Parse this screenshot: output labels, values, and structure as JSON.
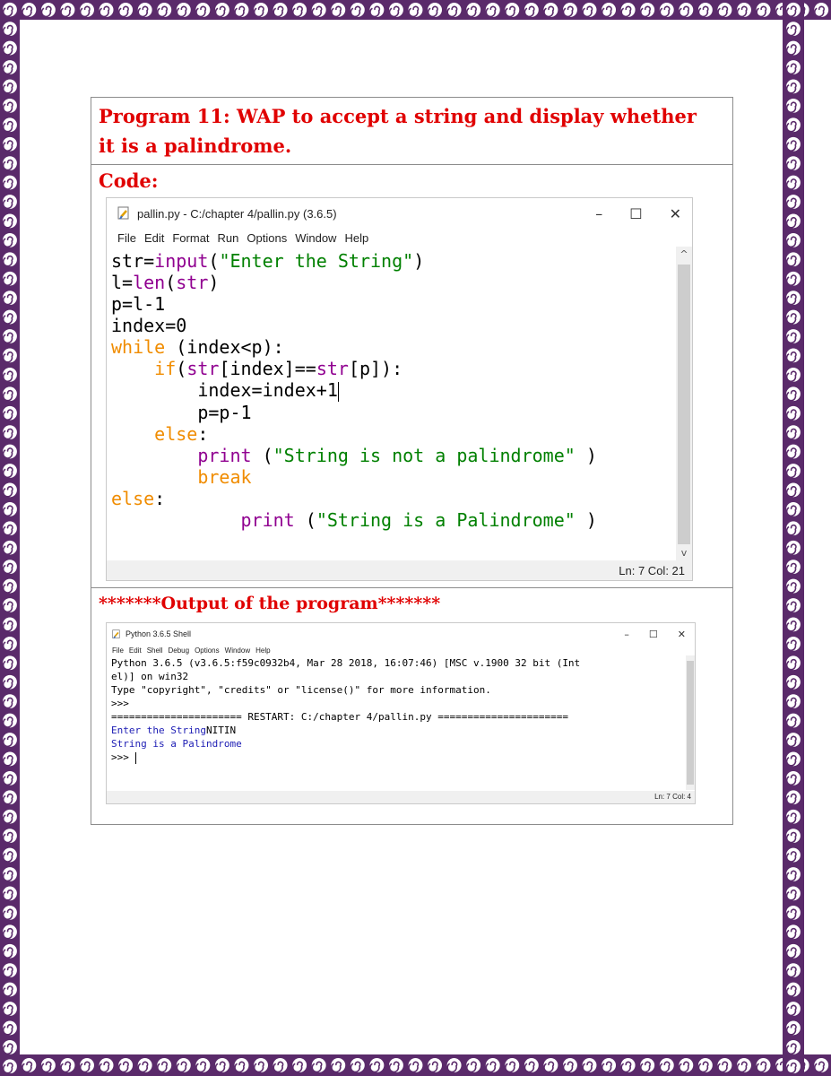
{
  "program_heading": "Program 11: WAP to accept a string and display whether it is a palindrome.",
  "code_label": "Code:",
  "editor": {
    "title": "pallin.py - C:/chapter 4/pallin.py (3.6.5)",
    "menu": [
      "File",
      "Edit",
      "Format",
      "Run",
      "Options",
      "Window",
      "Help"
    ],
    "window_buttons": {
      "minimize": "–",
      "maximize": "☐",
      "close": "✕"
    },
    "code_lines": [
      [
        {
          "t": "str=",
          "c": "plain"
        },
        {
          "t": "input",
          "c": "bi"
        },
        {
          "t": "(",
          "c": "plain"
        },
        {
          "t": "\"Enter the String\"",
          "c": "str"
        },
        {
          "t": ")",
          "c": "plain"
        }
      ],
      [
        {
          "t": "l=",
          "c": "plain"
        },
        {
          "t": "len",
          "c": "bi"
        },
        {
          "t": "(",
          "c": "plain"
        },
        {
          "t": "str",
          "c": "bi"
        },
        {
          "t": ")",
          "c": "plain"
        }
      ],
      [
        {
          "t": "p=l-1",
          "c": "plain"
        }
      ],
      [
        {
          "t": "index=0",
          "c": "plain"
        }
      ],
      [
        {
          "t": "while",
          "c": "kw"
        },
        {
          "t": " (index<p):",
          "c": "plain"
        }
      ],
      [
        {
          "t": "    ",
          "c": "plain"
        },
        {
          "t": "if",
          "c": "kw"
        },
        {
          "t": "(",
          "c": "plain"
        },
        {
          "t": "str",
          "c": "bi"
        },
        {
          "t": "[index]==",
          "c": "plain"
        },
        {
          "t": "str",
          "c": "bi"
        },
        {
          "t": "[p]):",
          "c": "plain"
        }
      ],
      [
        {
          "t": "        index=index+1",
          "c": "plain"
        },
        {
          "t": "",
          "c": "cursor"
        }
      ],
      [
        {
          "t": "        p=p-1",
          "c": "plain"
        }
      ],
      [
        {
          "t": "    ",
          "c": "plain"
        },
        {
          "t": "else",
          "c": "kw"
        },
        {
          "t": ":",
          "c": "plain"
        }
      ],
      [
        {
          "t": "        ",
          "c": "plain"
        },
        {
          "t": "print",
          "c": "bi"
        },
        {
          "t": " (",
          "c": "plain"
        },
        {
          "t": "\"String is not a palindrome\"",
          "c": "str"
        },
        {
          "t": " )",
          "c": "plain"
        }
      ],
      [
        {
          "t": "        ",
          "c": "plain"
        },
        {
          "t": "break",
          "c": "kw"
        }
      ],
      [
        {
          "t": "else",
          "c": "kw"
        },
        {
          "t": ":",
          "c": "plain"
        }
      ],
      [
        {
          "t": "            ",
          "c": "plain"
        },
        {
          "t": "print",
          "c": "bi"
        },
        {
          "t": " (",
          "c": "plain"
        },
        {
          "t": "\"String is a Palindrome\"",
          "c": "str"
        },
        {
          "t": " )",
          "c": "plain"
        }
      ]
    ],
    "status": "Ln: 7   Col: 21"
  },
  "output_label": "*******Output of the program*******",
  "shell": {
    "title": "Python 3.6.5 Shell",
    "menu": [
      "File",
      "Edit",
      "Shell",
      "Debug",
      "Options",
      "Window",
      "Help"
    ],
    "window_buttons": {
      "minimize": "–",
      "maximize": "☐",
      "close": "✕"
    },
    "lines": [
      [
        {
          "t": "Python 3.6.5 (v3.6.5:f59c0932b4, Mar 28 2018, 16:07:46) [MSC v.1900 32 bit (Int",
          "c": "plain"
        }
      ],
      [
        {
          "t": "el)] on win32",
          "c": "plain"
        }
      ],
      [
        {
          "t": "Type \"copyright\", \"credits\" or \"license()\" for more information.",
          "c": "plain"
        }
      ],
      [
        {
          "t": ">>>",
          "c": "plain"
        }
      ],
      [
        {
          "t": "====================== RESTART: C:/chapter 4/pallin.py ======================",
          "c": "plain"
        }
      ],
      [
        {
          "t": "Enter the String",
          "c": "shellout"
        },
        {
          "t": "NITIN",
          "c": "plain"
        }
      ],
      [
        {
          "t": "String is a Palindrome",
          "c": "shellout"
        }
      ],
      [
        {
          "t": ">>> ",
          "c": "plain"
        },
        {
          "t": "",
          "c": "cursor"
        }
      ]
    ],
    "status": "Ln: 7   Col: 4"
  },
  "colors": {
    "heading": "#e00000",
    "border_pattern": "#5a2a6a",
    "keyword": "#f08c00",
    "builtin": "#900090",
    "string": "#008000",
    "shell_output": "#1c1cb4"
  },
  "icons": [
    "python-file-icon",
    "spiral-border-icon"
  ]
}
